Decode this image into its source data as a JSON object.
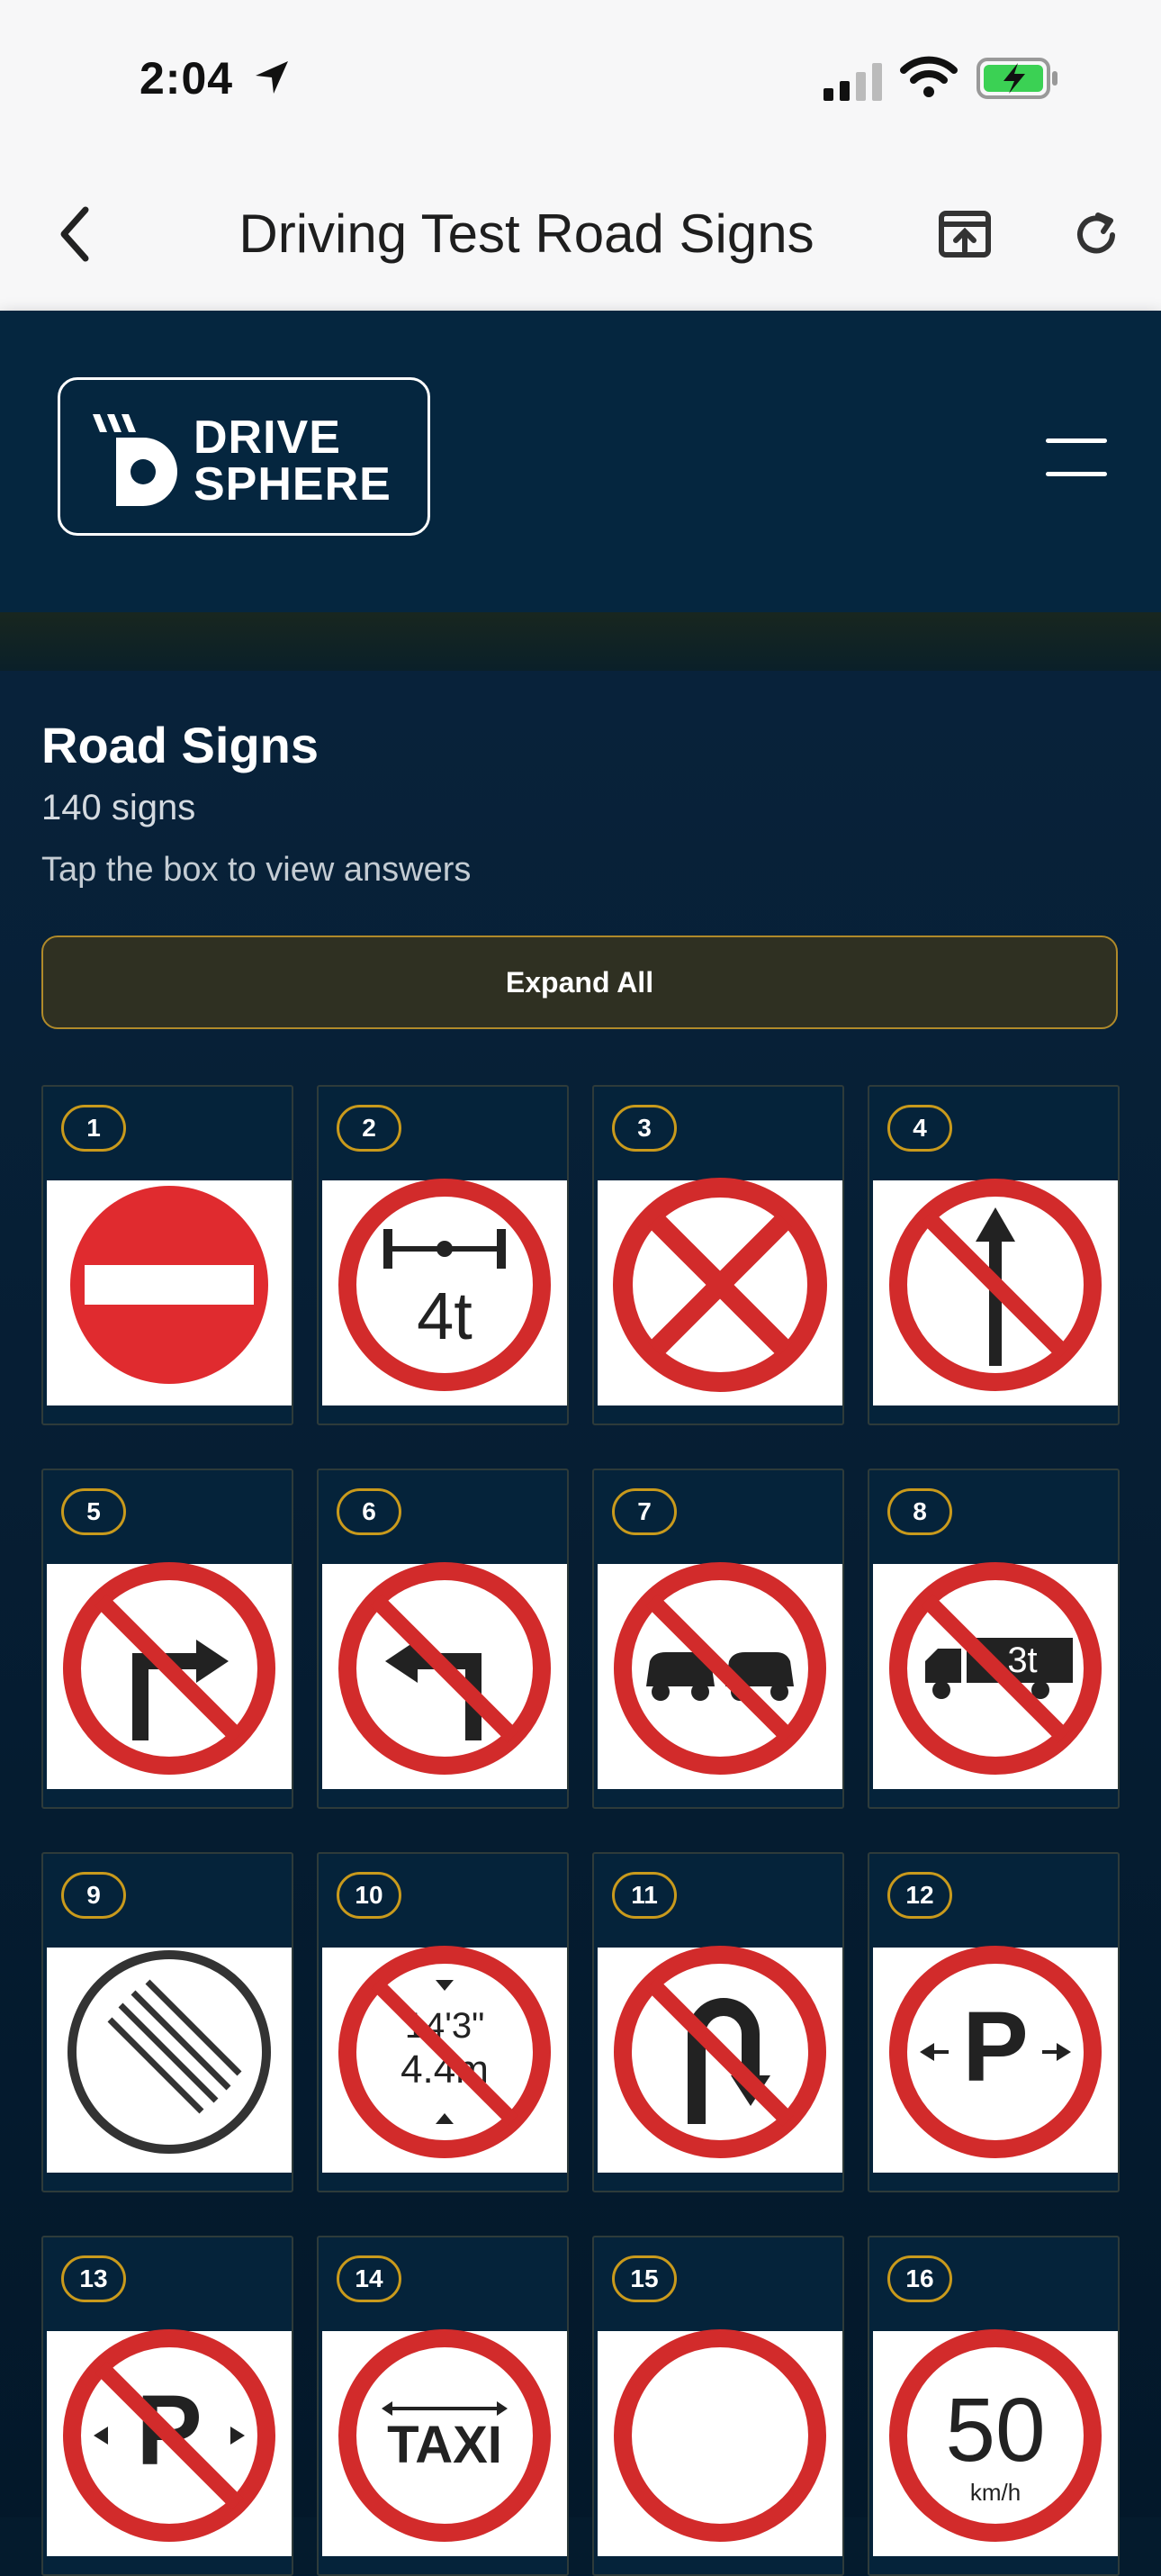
{
  "status": {
    "time": "2:04"
  },
  "nav": {
    "title": "Driving Test Road Signs"
  },
  "header": {
    "logo_line1": "DRIVE",
    "logo_line2": "SPHERE"
  },
  "page": {
    "heading": "Road Signs",
    "count": "140 signs",
    "hint": "Tap the box to view answers",
    "expand_label": "Expand All"
  },
  "signs": [
    {
      "number": "1",
      "icon": "no-entry-icon"
    },
    {
      "number": "2",
      "icon": "axle-weight-4t-icon",
      "text": "4t"
    },
    {
      "number": "3",
      "icon": "no-stopping-icon"
    },
    {
      "number": "4",
      "icon": "no-straight-ahead-icon"
    },
    {
      "number": "5",
      "icon": "no-right-turn-icon"
    },
    {
      "number": "6",
      "icon": "no-left-turn-icon"
    },
    {
      "number": "7",
      "icon": "no-overtaking-icon"
    },
    {
      "number": "8",
      "icon": "no-trucks-3t-icon",
      "text": "3t"
    },
    {
      "number": "9",
      "icon": "end-of-restriction-icon"
    },
    {
      "number": "10",
      "icon": "height-limit-icon",
      "text": "14'3\"",
      "text2": "4.4m"
    },
    {
      "number": "11",
      "icon": "no-u-turn-icon"
    },
    {
      "number": "12",
      "icon": "parking-icon",
      "text": "P"
    },
    {
      "number": "13",
      "icon": "no-parking-icon",
      "text": "P"
    },
    {
      "number": "14",
      "icon": "taxi-icon",
      "text": "TAXI"
    },
    {
      "number": "15",
      "icon": "no-vehicles-icon"
    },
    {
      "number": "16",
      "icon": "speed-limit-50-icon",
      "text": "50",
      "text2": "km/h"
    }
  ]
}
